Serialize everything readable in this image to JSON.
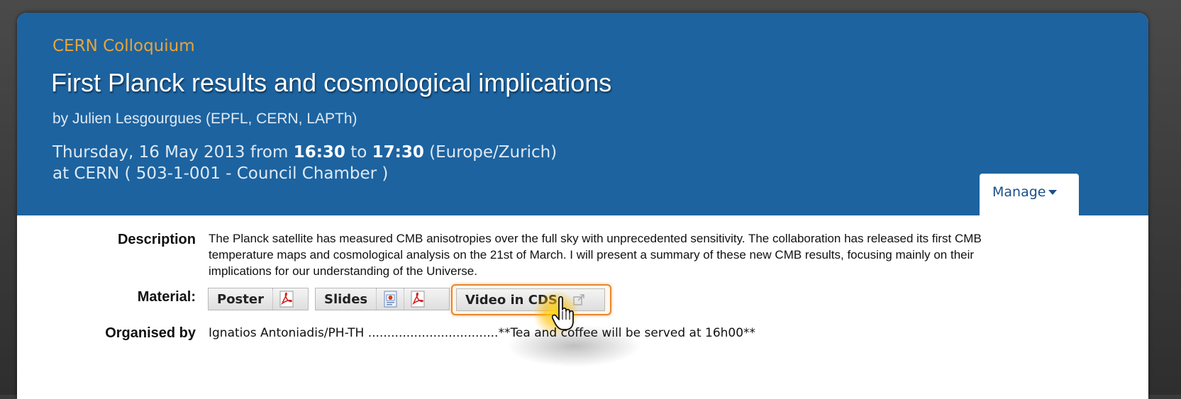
{
  "event": {
    "category": "CERN Colloquium",
    "title": "First Planck results and cosmological implications",
    "speaker": "by Julien Lesgourgues (EPFL, CERN, LAPTh)",
    "date_prefix": "Thursday, 16 May 2013 from ",
    "start_time": "16:30",
    "to": " to ",
    "end_time": "17:30",
    "timezone": " (Europe/Zurich)",
    "location": "at CERN ( 503-1-001 - Council Chamber )"
  },
  "manage": {
    "label": "Manage",
    "icon": "caret-down-icon"
  },
  "details": {
    "description_label": "Description",
    "description": "The Planck satellite has measured CMB anisotropies over the full sky with unprecedented sensitivity. The collaboration has released its first CMB temperature maps and cosmological analysis on the 21st of March. I will present a summary of these new CMB results, focusing mainly on their implications for our understanding of the Universe.",
    "material_label": "Material:",
    "materials": [
      {
        "name": "Poster",
        "icons": [
          "pdf-icon"
        ]
      },
      {
        "name": "Slides",
        "icons": [
          "ppt-icon",
          "pdf-icon"
        ]
      },
      {
        "name": "Video in CDS",
        "icons": [
          "external-link-icon"
        ]
      }
    ],
    "organised_label": "Organised by",
    "organised_by": "Ignatios Antoniadis/PH-TH ..................................**Tea and coffee will be served at 16h00**"
  },
  "colors": {
    "header": "#1c63a0",
    "category": "#e8a53a",
    "highlight": "#e8862a"
  }
}
